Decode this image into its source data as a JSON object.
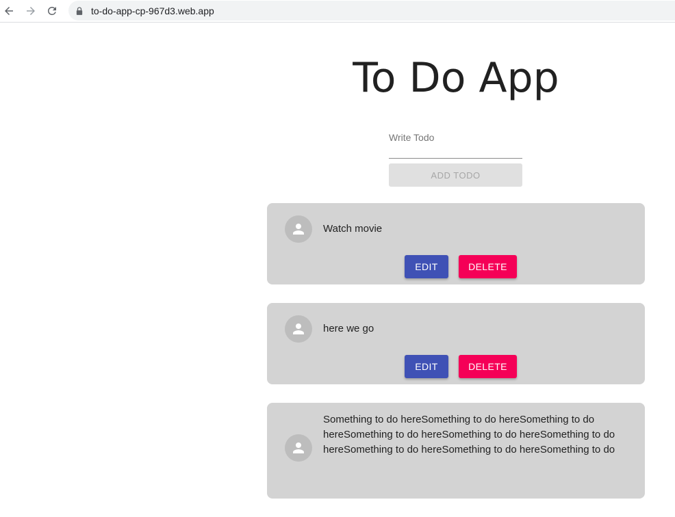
{
  "browser": {
    "url": "to-do-app-cp-967d3.web.app",
    "back_icon": "arrow-left-icon",
    "forward_icon": "arrow-right-icon",
    "reload_icon": "reload-icon",
    "lock_icon": "lock-icon"
  },
  "app": {
    "title": "To Do App",
    "input_label": "Write Todo",
    "input_value": "",
    "add_button_label": "ADD TODO"
  },
  "todos": [
    {
      "text": "Watch movie",
      "edit_label": "EDIT",
      "delete_label": "DELETE"
    },
    {
      "text": "here we go",
      "edit_label": "EDIT",
      "delete_label": "DELETE"
    },
    {
      "text": "Something to do hereSomething to do hereSomething to do hereSomething to do hereSomething to do hereSomething to do hereSomething to do hereSomething to do hereSomething to do"
    }
  ],
  "colors": {
    "card_bg": "#d3d3d3",
    "edit_button": "#3f51b5",
    "delete_button": "#f50057",
    "avatar_bg": "#bdbdbd"
  }
}
